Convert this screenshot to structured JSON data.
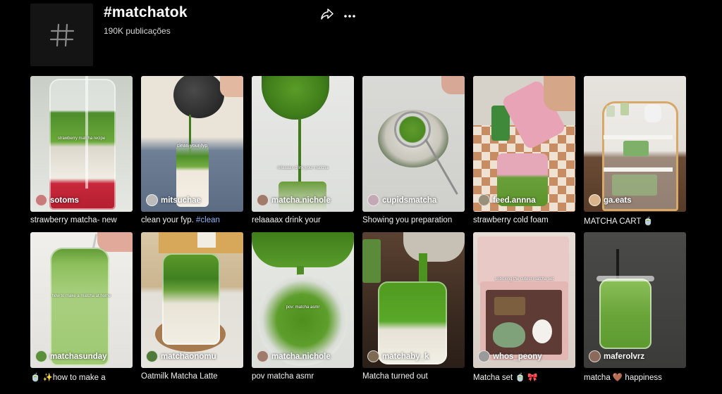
{
  "header": {
    "title": "#matchatok",
    "post_count": "190K publicações"
  },
  "icons": {
    "avatar": "hashtag-icon",
    "share": "share-icon",
    "more": "more-icon"
  },
  "videos": [
    {
      "author": "sotoms",
      "caption": "strawberry matcha- new",
      "overlay": "strawberry matcha recipe"
    },
    {
      "author": "mitsuchae",
      "caption": "clean your fyp.",
      "caption_tag": "#clean",
      "overlay": "clean your fyp"
    },
    {
      "author": "matcha.nichole",
      "caption": "relaaaax drink your",
      "overlay": "relaaaax drink your matcha"
    },
    {
      "author": "cupidsmatcha",
      "caption": "Showing you preparation",
      "overlay": ""
    },
    {
      "author": "feed.annna",
      "caption": "strawberry cold foam",
      "overlay": ""
    },
    {
      "author": "ga.eats",
      "caption": "MATCHA CART 🍵",
      "overlay": ""
    },
    {
      "author": "matchasunday",
      "caption": "🍵 ✨how to make a",
      "overlay": "how to make a matcha at home"
    },
    {
      "author": "matchaonomu",
      "caption": "Oatmilk Matcha Latte",
      "overlay": ""
    },
    {
      "author": "matcha.nichole",
      "caption": "pov matcha asmr",
      "overlay": "pov: matcha asmr"
    },
    {
      "author": "matchaby_k",
      "caption": "Matcha turned out",
      "overlay": ""
    },
    {
      "author": "whos_peony",
      "caption": "Matcha set 🍵 🎀",
      "overlay": "unboxing the cutest matcha set"
    },
    {
      "author": "maferolvrz",
      "caption": "matcha 🤎 happiness",
      "overlay": ""
    }
  ],
  "colors": {
    "background": "#000000",
    "matcha_green": "#5b9a2a",
    "strawberry_red": "#c8283a",
    "hashtag_link": "#8ab4f8"
  }
}
